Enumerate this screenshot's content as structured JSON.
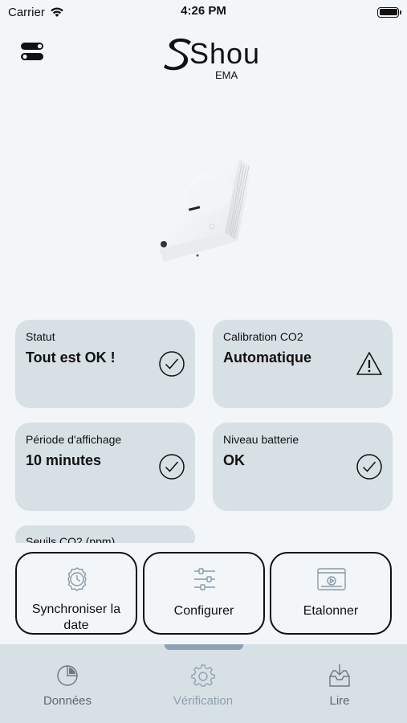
{
  "status_bar": {
    "carrier": "Carrier",
    "time": "4:26 PM"
  },
  "header": {
    "logo_text": "Shou",
    "logo_sub": "EMA"
  },
  "cards": [
    {
      "label": "Statut",
      "value": "Tout est OK !",
      "icon": "check-circle-icon"
    },
    {
      "label": "Calibration CO2",
      "value": "Automatique",
      "icon": "warning-triangle-icon"
    },
    {
      "label": "Période d'affichage",
      "value": "10 minutes",
      "icon": "check-circle-icon"
    },
    {
      "label": "Niveau batterie",
      "value": "OK",
      "icon": "check-circle-icon"
    },
    {
      "label": "Seuils CO2 (ppm)"
    }
  ],
  "actions": [
    {
      "label": "Synchroniser la date",
      "icon": "clock-gear-icon"
    },
    {
      "label": "Configurer",
      "icon": "sliders-icon"
    },
    {
      "label": "Etalonner",
      "icon": "video-player-icon"
    }
  ],
  "tabs": [
    {
      "label": "Données",
      "icon": "pie-chart-icon",
      "active": false
    },
    {
      "label": "Vérification",
      "icon": "gear-icon",
      "active": true
    },
    {
      "label": "Lire",
      "icon": "inbox-download-icon",
      "active": false
    }
  ],
  "colors": {
    "background": "#f2f6f8",
    "card": "#d7e0e5",
    "tab_active": "#8ea0af",
    "tab_inactive": "#5d6770"
  }
}
